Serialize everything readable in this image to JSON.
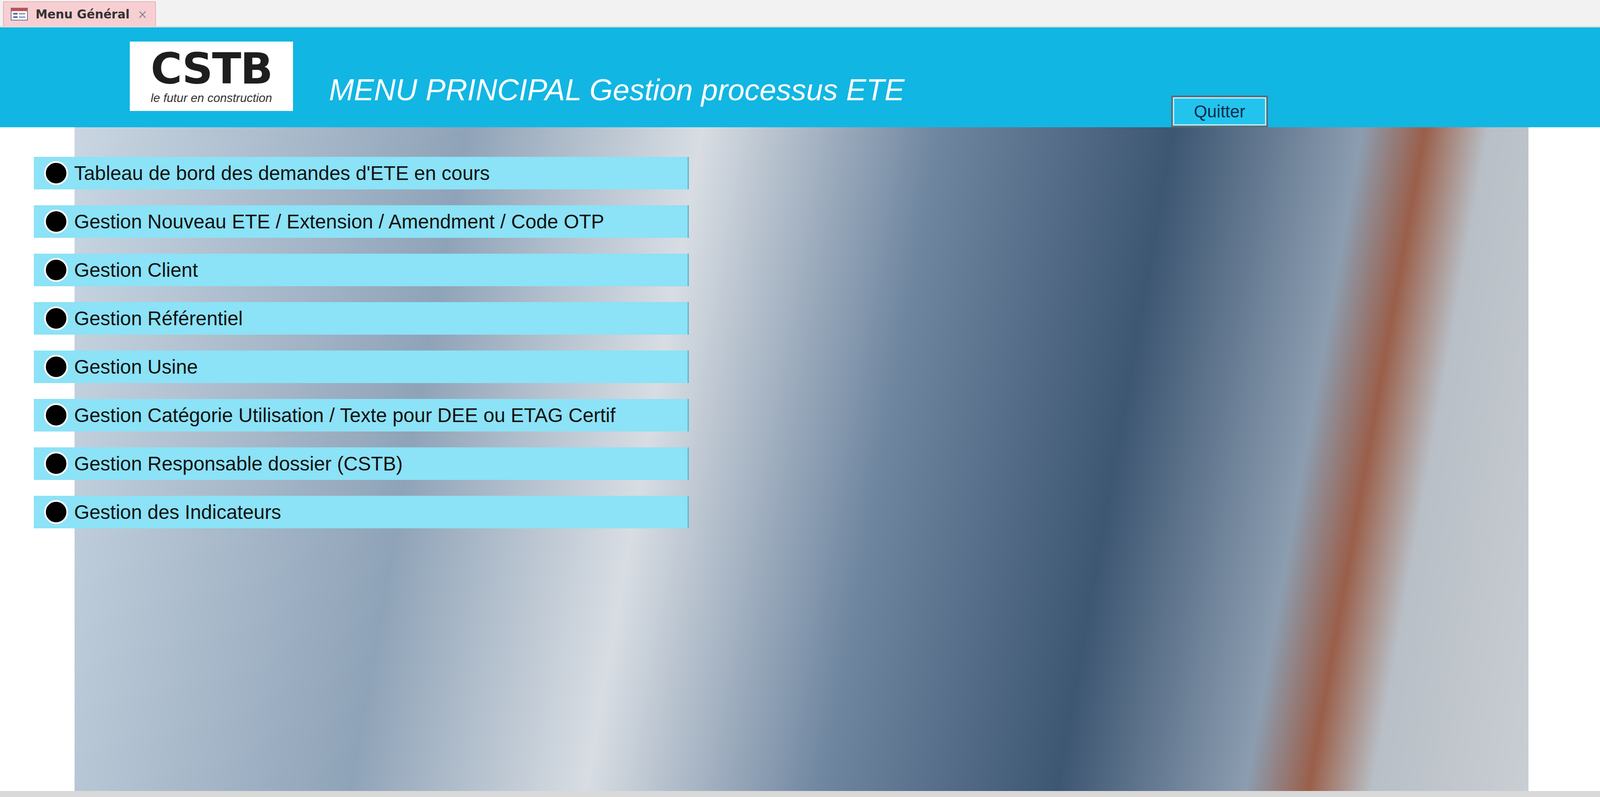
{
  "tabs": [
    {
      "label": "Menu Général",
      "selected": true,
      "close": "×"
    }
  ],
  "header": {
    "logo": {
      "name": "CSTB",
      "tagline": "le futur en construction"
    },
    "title": "MENU PRINCIPAL Gestion processus ETE",
    "quit_button": "Quitter"
  },
  "menu": {
    "items": [
      {
        "label": "Tableau de bord des demandes d'ETE en cours"
      },
      {
        "label": "Gestion Nouveau ETE / Extension / Amendment / Code OTP"
      },
      {
        "label": "Gestion Client"
      },
      {
        "label": "Gestion Référentiel"
      },
      {
        "label": "Gestion Usine"
      },
      {
        "label": "Gestion Catégorie Utilisation / Texte pour DEE ou ETAG Certif"
      },
      {
        "label": "Gestion Responsable dossier (CSTB)"
      },
      {
        "label": "Gestion des Indicateurs"
      }
    ]
  }
}
